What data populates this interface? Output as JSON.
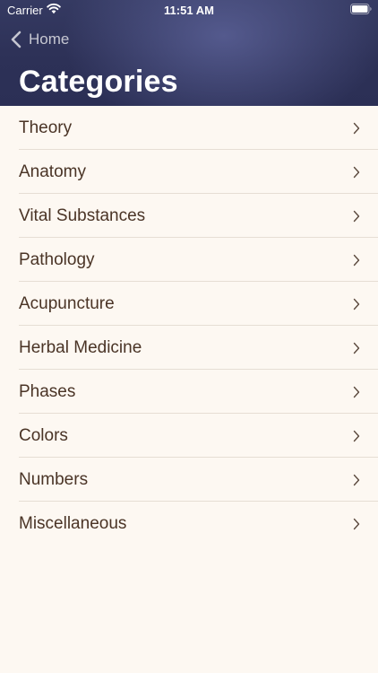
{
  "status_bar": {
    "carrier": "Carrier",
    "time": "11:51 AM",
    "wifi_icon": "wifi-icon",
    "battery_icon": "battery-icon"
  },
  "nav": {
    "back_label": "Home",
    "back_icon": "chevron-left-icon",
    "title": "Categories"
  },
  "colors": {
    "header_background": "#2d3157",
    "list_background": "#fdf8f2",
    "list_text": "#4a3426",
    "separator": "#e6ded4"
  },
  "categories": {
    "items": [
      {
        "label": "Theory",
        "icon": "chevron-right-icon"
      },
      {
        "label": "Anatomy",
        "icon": "chevron-right-icon"
      },
      {
        "label": "Vital Substances",
        "icon": "chevron-right-icon"
      },
      {
        "label": "Pathology",
        "icon": "chevron-right-icon"
      },
      {
        "label": "Acupuncture",
        "icon": "chevron-right-icon"
      },
      {
        "label": "Herbal Medicine",
        "icon": "chevron-right-icon"
      },
      {
        "label": "Phases",
        "icon": "chevron-right-icon"
      },
      {
        "label": "Colors",
        "icon": "chevron-right-icon"
      },
      {
        "label": "Numbers",
        "icon": "chevron-right-icon"
      },
      {
        "label": "Miscellaneous",
        "icon": "chevron-right-icon"
      }
    ]
  }
}
